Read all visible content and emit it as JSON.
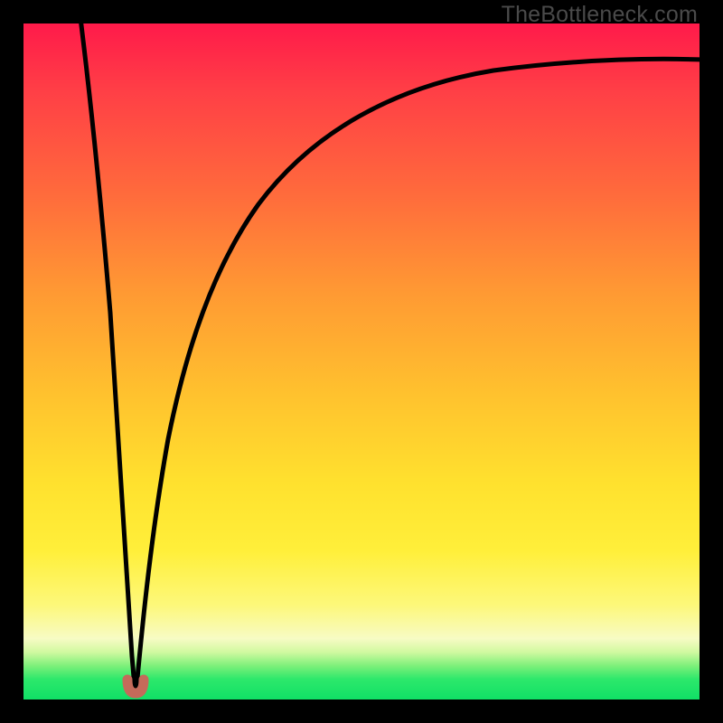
{
  "watermark": "TheBottleneck.com",
  "accent_colors": {
    "top": "#ff1a4a",
    "mid": "#ffe12e",
    "bottom": "#10e066",
    "curve": "#000000",
    "marker": "#c46a5a"
  },
  "chart_data": {
    "type": "line",
    "title": "",
    "xlabel": "",
    "ylabel": "",
    "xlim": [
      0,
      100
    ],
    "ylim": [
      0,
      100
    ],
    "notch_x": 16.5,
    "series": [
      {
        "name": "left_branch",
        "x": [
          12.0,
          12.8,
          13.5,
          14.3,
          15.0,
          15.6,
          16.1,
          16.5
        ],
        "y": [
          100.0,
          86.0,
          72.0,
          57.0,
          42.0,
          27.0,
          12.0,
          1.0
        ]
      },
      {
        "name": "right_branch",
        "x": [
          16.5,
          17.5,
          19.0,
          21.0,
          24.0,
          28.0,
          33.0,
          40.0,
          48.0,
          58.0,
          70.0,
          84.0,
          100.0
        ],
        "y": [
          1.0,
          12.0,
          26.0,
          39.0,
          52.0,
          63.0,
          72.0,
          79.0,
          84.0,
          88.0,
          91.0,
          93.0,
          94.5
        ]
      }
    ],
    "marker": {
      "x": 16.5,
      "y": 0.8,
      "shape": "u"
    }
  }
}
